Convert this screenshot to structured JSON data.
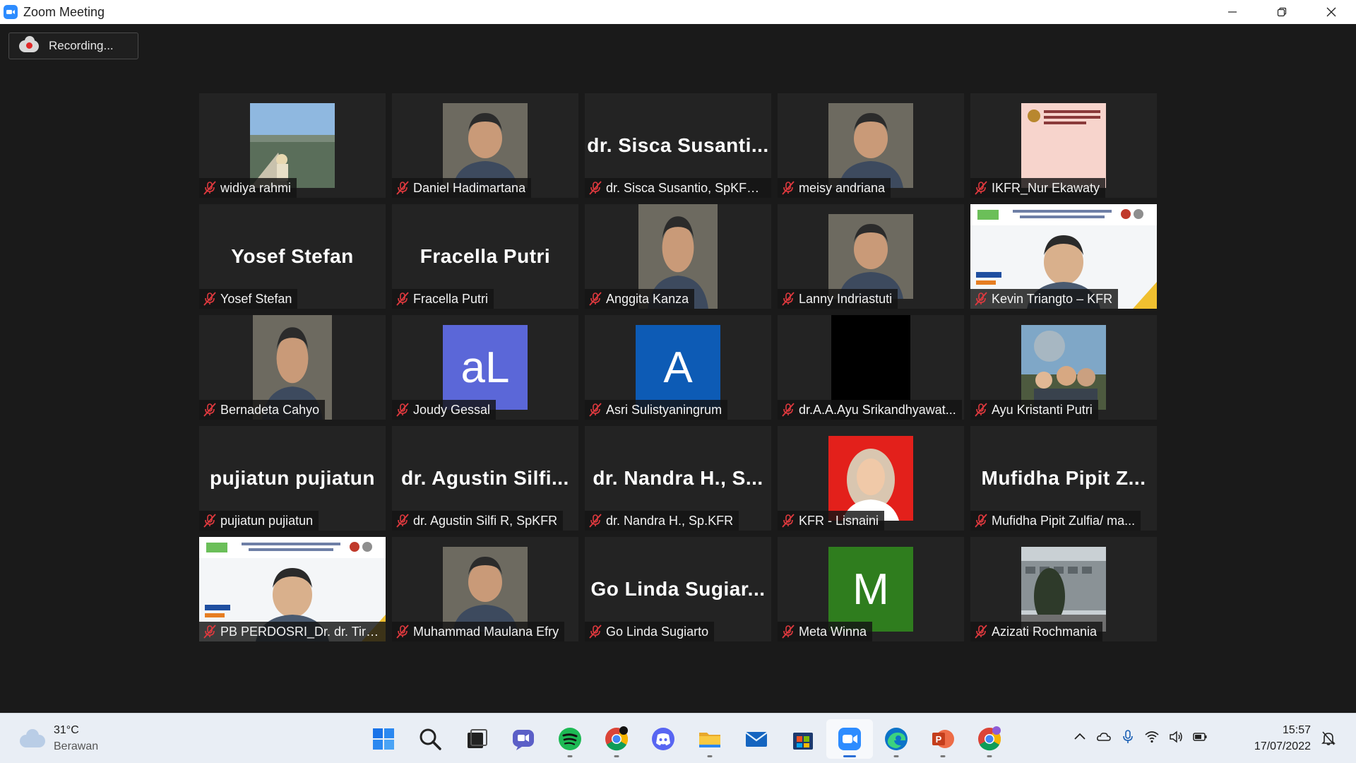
{
  "window": {
    "title": "Zoom Meeting"
  },
  "recording": {
    "label": "Recording..."
  },
  "participants": [
    {
      "name": "widiya rahmi",
      "video": "landscape"
    },
    {
      "name": "Daniel Hadimartana",
      "video": "person"
    },
    {
      "name": "dr. Sisca Susantio, SpKFR(...",
      "display": "dr. Sisca Susanti..."
    },
    {
      "name": "meisy andriana",
      "video": "person"
    },
    {
      "name": "IKFR_Nur Ekawaty",
      "video": "logo"
    },
    {
      "name": "Yosef Stefan",
      "display": "Yosef Stefan"
    },
    {
      "name": "Fracella Putri",
      "display": "Fracella Putri"
    },
    {
      "name": "Anggita Kanza",
      "video": "person"
    },
    {
      "name": "Lanny Indriastuti",
      "video": "person"
    },
    {
      "name": "Kevin Triangto – KFR",
      "video": "banner"
    },
    {
      "name": "Bernadeta Cahyo",
      "video": "person"
    },
    {
      "name": "Joudy Gessal",
      "avatar": "aL",
      "color": "#5b67d8"
    },
    {
      "name": "Asri Sulistyaningrum",
      "avatar": "A",
      "color": "#0d5bb5"
    },
    {
      "name": "dr.A.A.Ayu Srikandhyawat...",
      "video": "black"
    },
    {
      "name": "Ayu Kristanti Putri",
      "video": "group"
    },
    {
      "name": "pujiatun pujiatun",
      "display": "pujiatun pujiatun"
    },
    {
      "name": "dr. Agustin Silfi R, SpKFR",
      "display": "dr. Agustin Silfi..."
    },
    {
      "name": "dr. Nandra H., Sp.KFR",
      "display": "dr. Nandra H., S..."
    },
    {
      "name": "KFR - Lisnaini",
      "video": "redbg"
    },
    {
      "name": "Mufidha Pipit Zulfia/ ma...",
      "display": "Mufidha Pipit Z..."
    },
    {
      "name": "PB PERDOSRI_Dr. dr. Tirza Z. ...",
      "video": "banner"
    },
    {
      "name": "Muhammad Maulana Efry",
      "video": "person"
    },
    {
      "name": "Go Linda Sugiarto",
      "display": "Go Linda Sugiar..."
    },
    {
      "name": "Meta Winna",
      "avatar": "M",
      "color": "#2f7d1e"
    },
    {
      "name": "Azizati Rochmania",
      "video": "building"
    }
  ],
  "taskbar": {
    "weather": {
      "temp": "31°C",
      "condition": "Berawan"
    },
    "apps": [
      "start-icon",
      "search-icon",
      "task-view-icon",
      "teams-chat-icon",
      "spotify-icon",
      "chrome-icon",
      "discord-icon",
      "file-explorer-icon",
      "mail-icon",
      "store-icon",
      "zoom-icon",
      "edge-icon",
      "powerpoint-icon",
      "chrome-profile-icon"
    ],
    "clock": {
      "time": "15:57",
      "date": "17/07/2022"
    }
  },
  "colors": {
    "zoom_blue": "#2d8cff",
    "mic_muted": "#e0393e",
    "tile_bg": "#232323",
    "stage_bg": "#1a1a1a"
  }
}
